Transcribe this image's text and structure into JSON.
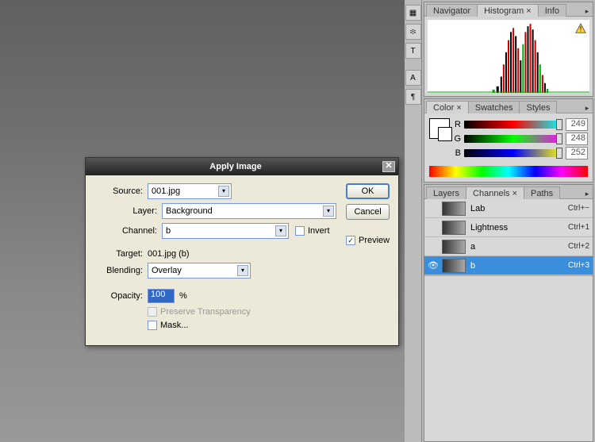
{
  "dialog": {
    "title": "Apply Image",
    "source_label": "Source:",
    "source_value": "001.jpg",
    "layer_label": "Layer:",
    "layer_value": "Background",
    "channel_label": "Channel:",
    "channel_value": "b",
    "invert_label": "Invert",
    "target_label": "Target:",
    "target_value": "001.jpg (b)",
    "blending_label": "Blending:",
    "blending_value": "Overlay",
    "opacity_label": "Opacity:",
    "opacity_value": "100",
    "opacity_unit": "%",
    "preserve_label": "Preserve Transparency",
    "mask_label": "Mask...",
    "ok": "OK",
    "cancel": "Cancel",
    "preview_label": "Preview",
    "preview_checked": true
  },
  "histogram_panel": {
    "tabs": [
      "Navigator",
      "Histogram",
      "Info"
    ],
    "active_tab": 1
  },
  "color_panel": {
    "tabs": [
      "Color",
      "Swatches",
      "Styles"
    ],
    "active_tab": 0,
    "channels": [
      {
        "label": "R",
        "value": "249"
      },
      {
        "label": "G",
        "value": "248"
      },
      {
        "label": "B",
        "value": "252"
      }
    ]
  },
  "channels_panel": {
    "tabs": [
      "Layers",
      "Channels",
      "Paths"
    ],
    "active_tab": 1,
    "rows": [
      {
        "name": "Lab",
        "shortcut": "Ctrl+~",
        "selected": false,
        "eye": false
      },
      {
        "name": "Lightness",
        "shortcut": "Ctrl+1",
        "selected": false,
        "eye": false
      },
      {
        "name": "a",
        "shortcut": "Ctrl+2",
        "selected": false,
        "eye": false
      },
      {
        "name": "b",
        "shortcut": "Ctrl+3",
        "selected": true,
        "eye": true
      }
    ]
  },
  "chart_data": {
    "type": "bar",
    "title": "Histogram",
    "xlabel": "",
    "ylabel": "",
    "categories_range": [
      0,
      255
    ],
    "series": [
      {
        "name": "Luminosity",
        "color": "#000000"
      },
      {
        "name": "Red",
        "color": "#ff0000"
      },
      {
        "name": "Green",
        "color": "#00aa00"
      }
    ],
    "note": "Pixel distribution concentrated between levels ~100 and ~220 with twin peaks near 150 and 200; exact per-bin counts not readable from screenshot."
  }
}
